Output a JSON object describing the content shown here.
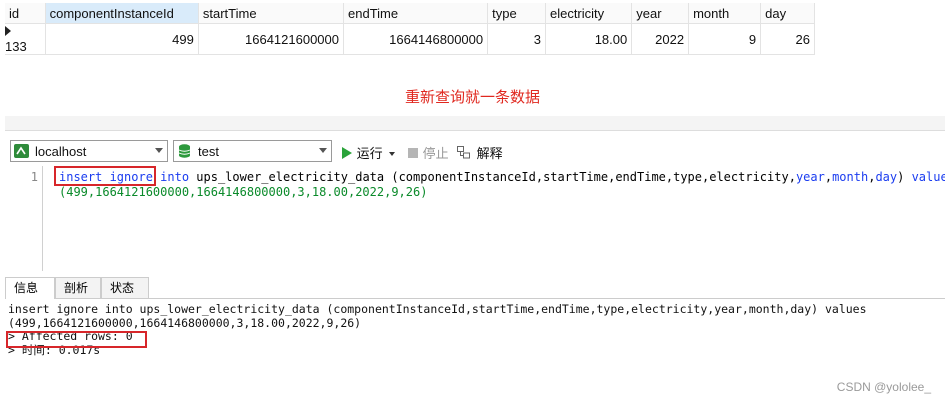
{
  "grid": {
    "columns": [
      "id",
      "componentInstanceId",
      "startTime",
      "endTime",
      "type",
      "electricity",
      "year",
      "month",
      "day"
    ],
    "rows": [
      [
        "133",
        "499",
        "1664121600000",
        "1664146800000",
        "3",
        "18.00",
        "2022",
        "9",
        "26"
      ]
    ]
  },
  "caption": "重新查询就一条数据",
  "toolbar": {
    "connection": "localhost",
    "database": "test",
    "run_label": "运行",
    "stop_label": "停止",
    "explain_label": "解释"
  },
  "editor": {
    "line_number": "1",
    "line1": {
      "kw_insert_ignore": "insert ignore",
      "kw_into": "into",
      "mid": " ups_lower_electricity_data (componentInstanceId,startTime,endTime,type,electricity,",
      "kw_year": "year",
      "kw_month": "month",
      "kw_day": "day",
      "kw_values": "values"
    },
    "line2": "(499,1664121600000,1664146800000,3,18.00,2022,9,26)"
  },
  "tabs": [
    "信息",
    "剖析",
    "状态"
  ],
  "output": {
    "line1": "insert ignore into ups_lower_electricity_data (componentInstanceId,startTime,endTime,type,electricity,year,month,day) values",
    "line2": "(499,1664121600000,1664146800000,3,18.00,2022,9,26)",
    "line3": "> Affected rows: 0",
    "line4": "> 时间: 0.017s"
  },
  "watermark": "CSDN @yololee_",
  "colors": {
    "highlight_border": "#d7262a",
    "caption": "#e0281f",
    "keyword": "#1a3cf0",
    "number": "#0a8a2a"
  }
}
